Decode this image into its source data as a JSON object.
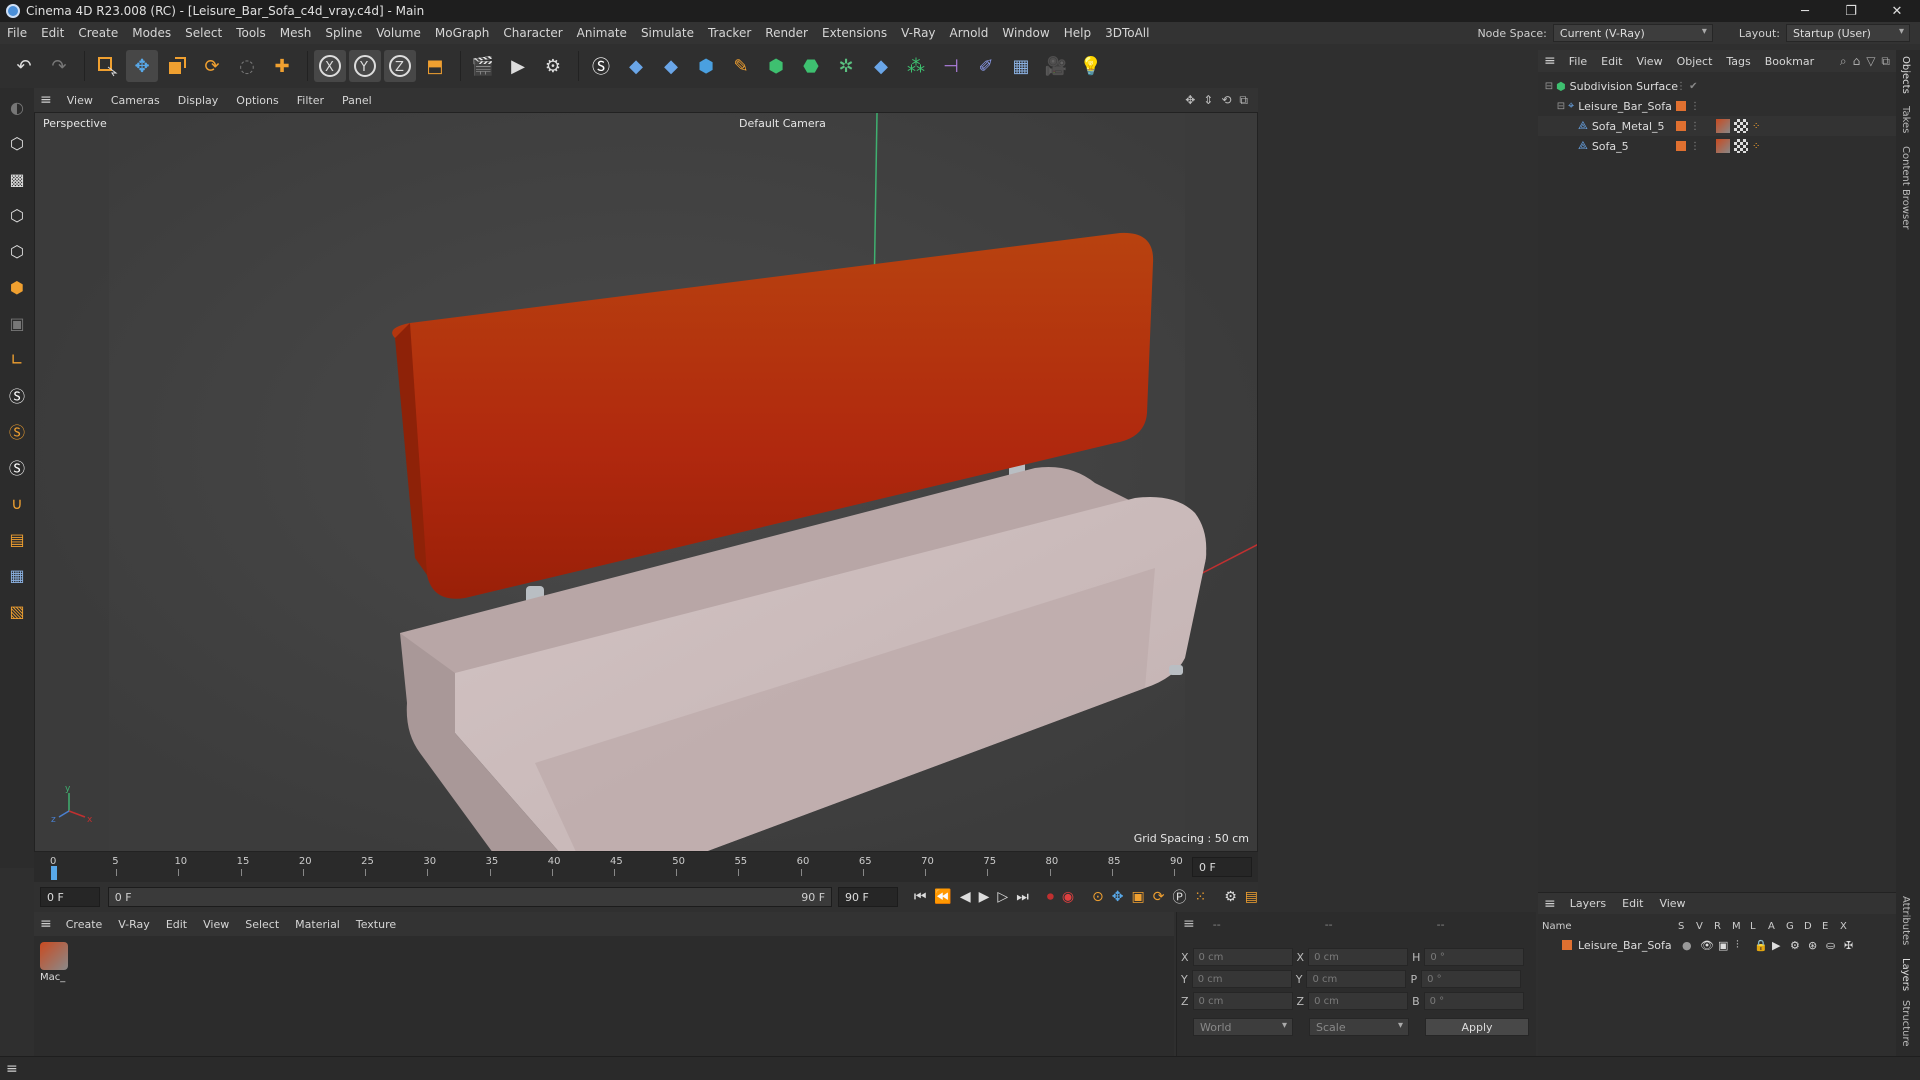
{
  "window": {
    "title": "Cinema 4D R23.008 (RC) - [Leisure_Bar_Sofa_c4d_vray.c4d] - Main",
    "minimize": "─",
    "restore": "❐",
    "close": "✕"
  },
  "menubar": {
    "items": [
      "File",
      "Edit",
      "Create",
      "Modes",
      "Select",
      "Tools",
      "Mesh",
      "Spline",
      "Volume",
      "MoGraph",
      "Character",
      "Animate",
      "Simulate",
      "Tracker",
      "Render",
      "Extensions",
      "V-Ray",
      "Arnold",
      "Window",
      "Help",
      "3DToAll"
    ],
    "node_space_label": "Node Space:",
    "node_space_value": "Current (V-Ray)",
    "layout_label": "Layout:",
    "layout_value": "Startup (User)"
  },
  "viewport": {
    "menu": [
      "View",
      "Cameras",
      "Display",
      "Options",
      "Filter",
      "Panel"
    ],
    "label": "Perspective",
    "camera": "Default Camera",
    "grid_spacing": "Grid Spacing : 50 cm",
    "colors": {
      "background": "#444444",
      "backrest": "#b23a10",
      "seat": "#c9b8b8"
    }
  },
  "timeline": {
    "ticks": [
      "0",
      "5",
      "10",
      "15",
      "20",
      "25",
      "30",
      "35",
      "40",
      "45",
      "50",
      "55",
      "60",
      "65",
      "70",
      "75",
      "80",
      "85",
      "90"
    ],
    "current_frame": "0 F"
  },
  "transport": {
    "start": "0 F",
    "range_start": "0 F",
    "range_end": "90 F",
    "end": "90 F"
  },
  "material_manager": {
    "menu": [
      "Create",
      "V-Ray",
      "Edit",
      "View",
      "Select",
      "Material",
      "Texture"
    ],
    "materials": [
      {
        "name": "Mac_"
      }
    ]
  },
  "coordinates": {
    "header_left": "--",
    "header_mid": "--",
    "header_right": "--",
    "rows": [
      {
        "a": "X",
        "av": "0 cm",
        "b": "X",
        "bv": "0 cm",
        "c": "H",
        "cv": "0 °"
      },
      {
        "a": "Y",
        "av": "0 cm",
        "b": "Y",
        "bv": "0 cm",
        "c": "P",
        "cv": "0 °"
      },
      {
        "a": "Z",
        "av": "0 cm",
        "b": "Z",
        "bv": "0 cm",
        "c": "B",
        "cv": "0 °"
      }
    ],
    "mode": "World",
    "scale": "Scale",
    "apply": "Apply"
  },
  "objects": {
    "menu": [
      "File",
      "Edit",
      "View",
      "Object",
      "Tags",
      "Bookmar"
    ],
    "items": [
      {
        "name": "Subdivision Surface",
        "indent": 0
      },
      {
        "name": "Leisure_Bar_Sofa",
        "indent": 1
      },
      {
        "name": "Sofa_Metal_5",
        "indent": 2
      },
      {
        "name": "Sofa_5",
        "indent": 2
      }
    ]
  },
  "layers": {
    "menu": [
      "Layers",
      "Edit",
      "View"
    ],
    "header_name": "Name",
    "header_cols": [
      "S",
      "V",
      "R",
      "M",
      "L",
      "A",
      "G",
      "D",
      "E",
      "X"
    ],
    "items": [
      {
        "name": "Leisure_Bar_Sofa",
        "color": "#e07030"
      }
    ]
  },
  "side_tabs": [
    "Objects",
    "Takes",
    "Content Browser",
    "Attributes",
    "Layers",
    "Structure"
  ]
}
